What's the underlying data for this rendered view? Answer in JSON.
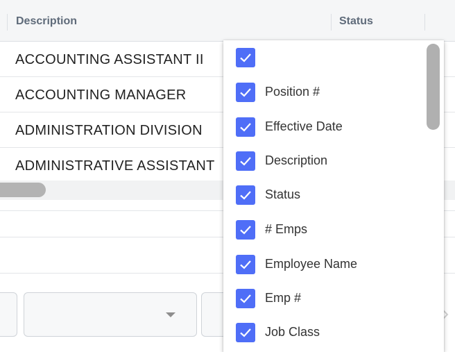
{
  "table": {
    "headers": {
      "description": "Description",
      "status": "Status"
    },
    "rows": [
      "ACCOUNTING ASSISTANT II",
      "ACCOUNTING MANAGER",
      "ADMINISTRATION DIVISION",
      "ADMINISTRATIVE ASSISTANT"
    ]
  },
  "column_menu": {
    "items": [
      {
        "label": "",
        "checked": true
      },
      {
        "label": "Position #",
        "checked": true
      },
      {
        "label": "Effective Date",
        "checked": true
      },
      {
        "label": "Description",
        "checked": true
      },
      {
        "label": "Status",
        "checked": true
      },
      {
        "label": "# Emps",
        "checked": true
      },
      {
        "label": "Employee Name",
        "checked": true
      },
      {
        "label": "Emp #",
        "checked": true
      },
      {
        "label": "Job Class",
        "checked": true
      }
    ]
  },
  "colors": {
    "checkbox_accent": "#4f6ef7",
    "header_background": "#f5f6f7",
    "header_text": "#5f6b7a"
  },
  "icons": {
    "checkbox": "check-icon",
    "dropdown": "caret-down-icon",
    "pager_next": "chevron-right-icon"
  }
}
